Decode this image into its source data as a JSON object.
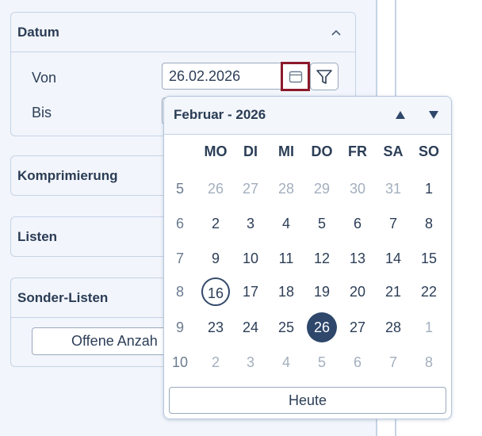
{
  "sections": {
    "datum": {
      "title": "Datum"
    },
    "komprimierung": {
      "title": "Komprimierung"
    },
    "listen": {
      "title": "Listen"
    },
    "sonder_listen": {
      "title": "Sonder-Listen",
      "button_label": "Offene Anzah"
    }
  },
  "date_filter": {
    "from_label": "Von",
    "from_value": "26.02.2026",
    "to_label": "Bis"
  },
  "icons": {
    "collapse": "chevron-up-icon",
    "calendar": "calendar-icon",
    "filter": "filter-icon",
    "prev_month": "triangle-up-icon",
    "next_month": "triangle-down-icon"
  },
  "calendar": {
    "title": "Februar - 2026",
    "weekdays": [
      "MO",
      "DI",
      "MI",
      "DO",
      "FR",
      "SA",
      "SO"
    ],
    "weeks": [
      {
        "week": "5",
        "days": [
          {
            "d": "26",
            "s": "other"
          },
          {
            "d": "27",
            "s": "other"
          },
          {
            "d": "28",
            "s": "other"
          },
          {
            "d": "29",
            "s": "other"
          },
          {
            "d": "30",
            "s": "other"
          },
          {
            "d": "31",
            "s": "other"
          },
          {
            "d": "1",
            "s": "normal"
          }
        ]
      },
      {
        "week": "6",
        "days": [
          {
            "d": "2",
            "s": "normal"
          },
          {
            "d": "3",
            "s": "normal"
          },
          {
            "d": "4",
            "s": "normal"
          },
          {
            "d": "5",
            "s": "normal"
          },
          {
            "d": "6",
            "s": "normal"
          },
          {
            "d": "7",
            "s": "normal"
          },
          {
            "d": "8",
            "s": "normal"
          }
        ]
      },
      {
        "week": "7",
        "days": [
          {
            "d": "9",
            "s": "normal"
          },
          {
            "d": "10",
            "s": "normal"
          },
          {
            "d": "11",
            "s": "normal"
          },
          {
            "d": "12",
            "s": "normal"
          },
          {
            "d": "13",
            "s": "normal"
          },
          {
            "d": "14",
            "s": "normal"
          },
          {
            "d": "15",
            "s": "normal"
          }
        ]
      },
      {
        "week": "8",
        "days": [
          {
            "d": "16",
            "s": "today"
          },
          {
            "d": "17",
            "s": "normal"
          },
          {
            "d": "18",
            "s": "normal"
          },
          {
            "d": "19",
            "s": "normal"
          },
          {
            "d": "20",
            "s": "normal"
          },
          {
            "d": "21",
            "s": "normal"
          },
          {
            "d": "22",
            "s": "normal"
          }
        ]
      },
      {
        "week": "9",
        "days": [
          {
            "d": "23",
            "s": "normal"
          },
          {
            "d": "24",
            "s": "normal"
          },
          {
            "d": "25",
            "s": "normal"
          },
          {
            "d": "26",
            "s": "selected"
          },
          {
            "d": "27",
            "s": "normal"
          },
          {
            "d": "28",
            "s": "normal"
          },
          {
            "d": "1",
            "s": "other"
          }
        ]
      },
      {
        "week": "10",
        "days": [
          {
            "d": "2",
            "s": "other"
          },
          {
            "d": "3",
            "s": "other"
          },
          {
            "d": "4",
            "s": "other"
          },
          {
            "d": "5",
            "s": "other"
          },
          {
            "d": "6",
            "s": "other"
          },
          {
            "d": "7",
            "s": "other"
          },
          {
            "d": "8",
            "s": "other"
          }
        ]
      }
    ],
    "today_button": "Heute"
  },
  "colors": {
    "panel_bg": "#f2f5fb",
    "border": "#c5d3e6",
    "text": "#2c3e57",
    "selected_bg": "#2e476b",
    "focus_outline": "#8b1a2b"
  }
}
